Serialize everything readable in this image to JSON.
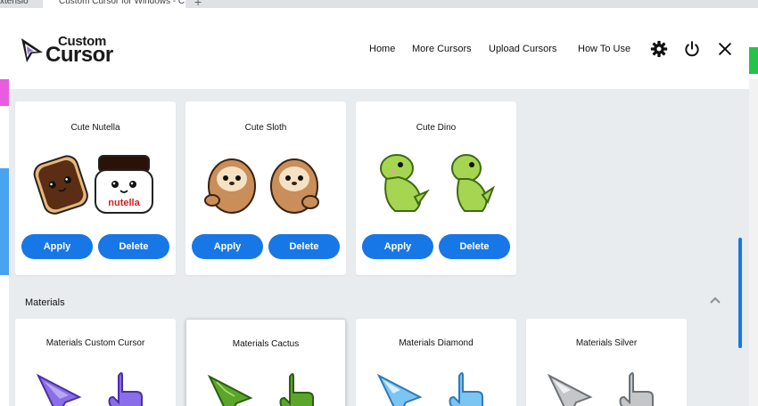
{
  "browser": {
    "tab1": "xtensio",
    "tab2": "Custom Cursor for Windows - C",
    "new_tab": "+"
  },
  "app": {
    "logo_line1": "Custom",
    "logo_line2": "Cursor",
    "nav": [
      "Home",
      "More Cursors",
      "Upload Cursors",
      "How To Use"
    ],
    "icons": [
      "gear-icon",
      "power-icon",
      "close-icon"
    ]
  },
  "packs": [
    {
      "title": "Cute Nutella",
      "apply": "Apply",
      "delete": "Delete",
      "label_on_jar": "nutella"
    },
    {
      "title": "Cute Sloth",
      "apply": "Apply",
      "delete": "Delete"
    },
    {
      "title": "Cute Dino",
      "apply": "Apply",
      "delete": "Delete"
    }
  ],
  "section": {
    "title": "Materials",
    "collapse_icon": "chevron-up-icon"
  },
  "materials": [
    {
      "title": "Materials Custom Cursor",
      "color": "#8a6de8"
    },
    {
      "title": "Materials Cactus",
      "color": "#5aa62a"
    },
    {
      "title": "Materials Diamond",
      "color": "#7cc5f2"
    },
    {
      "title": "Materials Silver",
      "color": "#c4c6c8"
    }
  ],
  "colors": {
    "accent": "#1877e6",
    "background": "#e8ecef"
  }
}
